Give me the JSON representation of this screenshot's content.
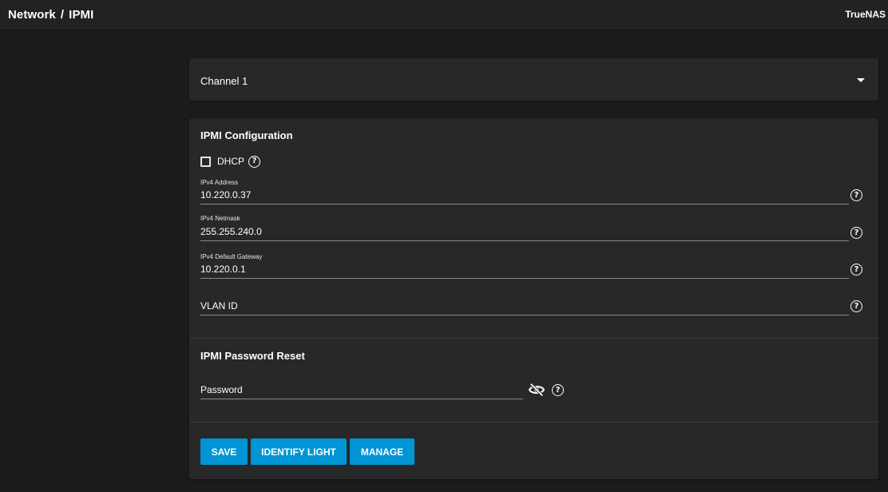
{
  "header": {
    "breadcrumb": [
      "Network",
      "IPMI"
    ],
    "separator": "/",
    "brand": "TrueNAS"
  },
  "channel": {
    "selected": "Channel 1"
  },
  "ipmi_config": {
    "title": "IPMI Configuration",
    "dhcp": {
      "label": "DHCP",
      "checked": false
    },
    "fields": {
      "ipv4_address": {
        "label": "IPv4 Address",
        "value": "10.220.0.37"
      },
      "ipv4_netmask": {
        "label": "IPv4 Netmask",
        "value": "255.255.240.0"
      },
      "ipv4_gateway": {
        "label": "IPv4 Default Gateway",
        "value": "10.220.0.1"
      },
      "vlan_id": {
        "placeholder": "VLAN ID"
      }
    }
  },
  "password_reset": {
    "title": "IPMI Password Reset",
    "password_placeholder": "Password"
  },
  "buttons": {
    "save": "SAVE",
    "identify": "IDENTIFY LIGHT",
    "manage": "MANAGE"
  },
  "icons": {
    "help": "help-circle-icon",
    "visibility": "eye-off-icon",
    "dropdown": "caret-down-icon"
  },
  "colors": {
    "accent": "#0095d5",
    "background": "#1b1b1b",
    "card": "#282828"
  }
}
